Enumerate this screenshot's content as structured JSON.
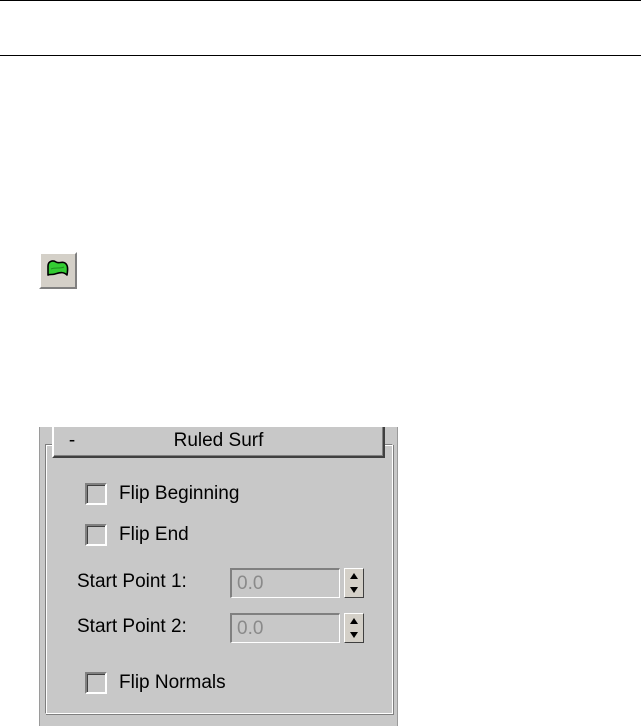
{
  "toolbar": {
    "icon": "ruled-surface-icon",
    "icon_color": "#33cc33"
  },
  "rollout": {
    "collapse_symbol": "-",
    "title": "Ruled Surf",
    "flip_beginning": {
      "label": "Flip Beginning",
      "checked": false
    },
    "flip_end": {
      "label": "Flip End",
      "checked": false
    },
    "start_point_1": {
      "label": "Start Point 1:",
      "value": "0.0"
    },
    "start_point_2": {
      "label": "Start Point 2:",
      "value": "0.0"
    },
    "flip_normals": {
      "label": "Flip Normals",
      "checked": false
    }
  },
  "colors": {
    "panel_bg": "#c8c8c8",
    "disabled_text": "#8a8a8a"
  }
}
